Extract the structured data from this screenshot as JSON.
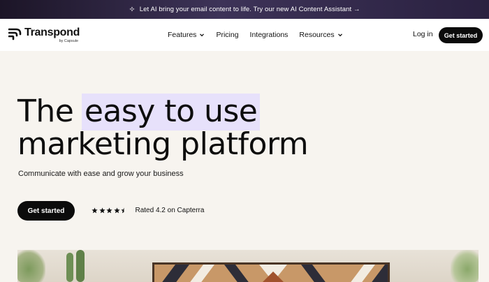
{
  "announcement": {
    "text": "Let AI bring your email content to life. Try our new AI Content Assistant →",
    "icon": "sparkle-icon"
  },
  "header": {
    "logo_word": "Transpond",
    "logo_by": "by Capsule",
    "nav": [
      {
        "label": "Features",
        "has_dropdown": true
      },
      {
        "label": "Pricing",
        "has_dropdown": false
      },
      {
        "label": "Integrations",
        "has_dropdown": false
      },
      {
        "label": "Resources",
        "has_dropdown": true
      }
    ],
    "login_label": "Log in",
    "cta_label": "Get started"
  },
  "hero": {
    "title_highlight": "easy to use",
    "title_prefix": "The",
    "title_line2": "marketing platform",
    "subtitle": "Communicate with ease and grow your business",
    "cta_label": "Get started",
    "rating_stars": 4.2,
    "rating_text": "Rated 4.2 on Capterra"
  },
  "colors": {
    "background": "#f7f4ef",
    "announcement_bar": "#2a2140",
    "button": "#0b0b0b",
    "highlight": "#e7e1fb"
  }
}
